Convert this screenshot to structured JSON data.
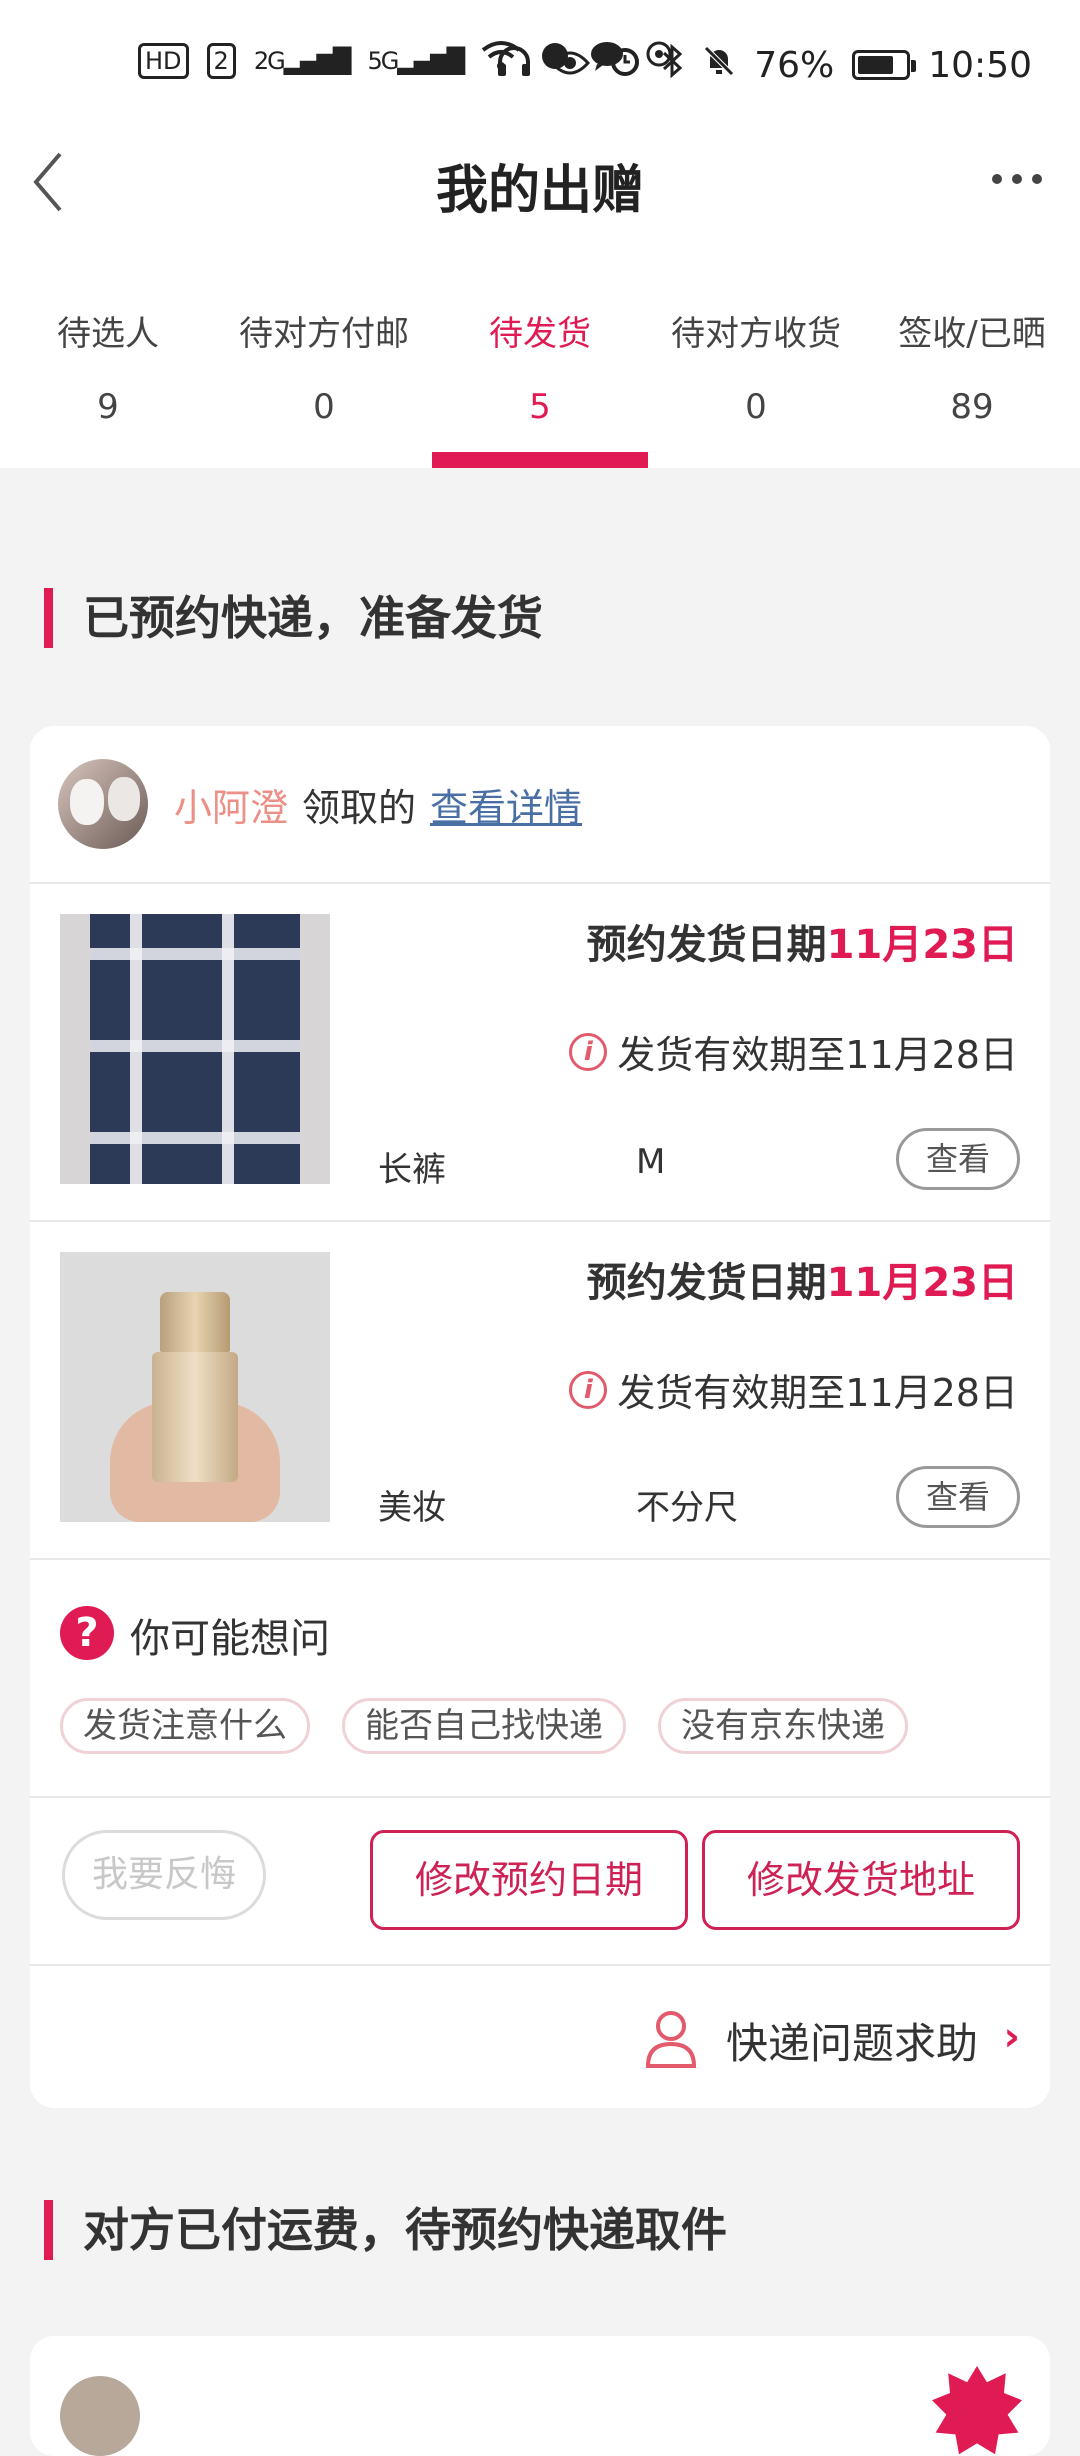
{
  "status_bar": {
    "hd": "HD",
    "sim": "2",
    "net1": "2G",
    "net2": "5G",
    "battery": "76%",
    "battery_level": 0.76,
    "time": "10:50"
  },
  "header": {
    "title": "我的出赠"
  },
  "tabs": [
    {
      "label": "待选人",
      "count": "9"
    },
    {
      "label": "待对方付邮",
      "count": "0"
    },
    {
      "label": "待发货",
      "count": "5",
      "active": true
    },
    {
      "label": "待对方收货",
      "count": "0"
    },
    {
      "label": "签收/已晒",
      "count": "89"
    }
  ],
  "section1": {
    "title": "已预约快递，准备发货"
  },
  "card": {
    "claimer_name": "小阿澄",
    "claim_text": "领取的",
    "detail_link": "查看详情",
    "items": [
      {
        "ship_prefix": "预约发货日期",
        "ship_date": "11月23日",
        "expire": "发货有效期至11月28日",
        "category": "长裤",
        "size": "M",
        "view_label": "查看"
      },
      {
        "ship_prefix": "预约发货日期",
        "ship_date": "11月23日",
        "expire": "发货有效期至11月28日",
        "category": "美妆",
        "size": "不分尺",
        "view_label": "查看"
      }
    ],
    "faq": {
      "title": "你可能想问",
      "chips": [
        "发货注意什么",
        "能否自己找快递",
        "没有京东快递"
      ]
    },
    "actions": {
      "regret": "我要反悔",
      "change_date": "修改预约日期",
      "change_address": "修改发货地址"
    },
    "help": "快递问题求助"
  },
  "section2": {
    "title": "对方已付运费，待预约快递取件"
  },
  "colors": {
    "accent": "#e01a52",
    "link": "#4a6fa5",
    "claimer": "#ec8f86"
  }
}
